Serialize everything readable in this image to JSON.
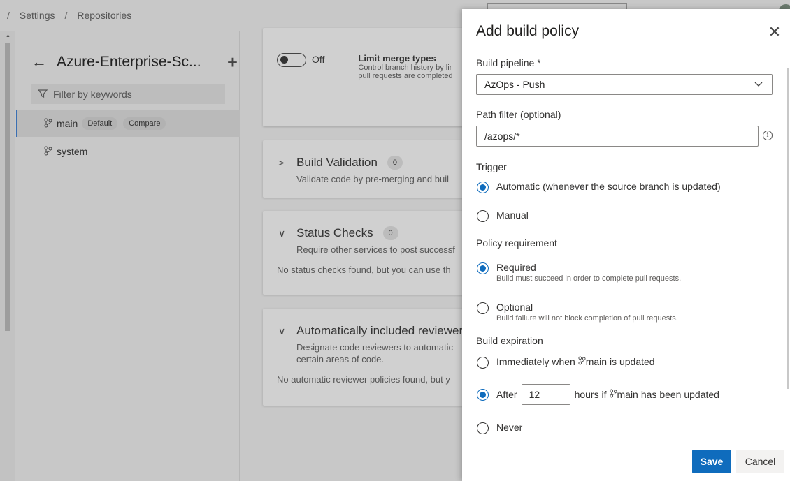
{
  "breadcrumb": {
    "items": [
      "Settings",
      "Repositories"
    ],
    "separator": "/"
  },
  "branches_panel": {
    "repo_name": "Azure-Enterprise-Sc...",
    "filter_placeholder": "Filter by keywords",
    "branches": [
      {
        "name": "main",
        "badges": [
          "Default",
          "Compare"
        ],
        "selected": true
      },
      {
        "name": "system",
        "badges": [],
        "selected": false
      }
    ]
  },
  "policies": {
    "merge_types": {
      "toggle_label": "Off",
      "title": "Limit merge types",
      "desc_line1": "Control branch history by lir",
      "desc_line2": "pull requests are completed"
    },
    "build_validation": {
      "title": "Build Validation",
      "count": "0",
      "desc": "Validate code by pre-merging and buil"
    },
    "status_checks": {
      "title": "Status Checks",
      "count": "0",
      "desc": "Require other services to post successf",
      "note": "No status checks found, but you can use th"
    },
    "reviewers": {
      "title": "Automatically included reviewer",
      "desc_line1": "Designate code reviewers to automatic",
      "desc_line2": "certain areas of code.",
      "note": "No automatic reviewer policies found, but y"
    }
  },
  "dialog": {
    "title": "Add build policy",
    "build_pipeline_label": "Build pipeline *",
    "build_pipeline_value": "AzOps - Push",
    "path_filter_label": "Path filter (optional)",
    "path_filter_value": "/azops/*",
    "trigger_label": "Trigger",
    "trigger_options": [
      {
        "label": "Automatic (whenever the source branch is updated)",
        "checked": true
      },
      {
        "label": "Manual",
        "checked": false
      }
    ],
    "requirement_label": "Policy requirement",
    "requirement_options": [
      {
        "label": "Required",
        "sub": "Build must succeed in order to complete pull requests.",
        "checked": true
      },
      {
        "label": "Optional",
        "sub": "Build failure will not block completion of pull requests.",
        "checked": false
      }
    ],
    "expiration_label": "Build expiration",
    "expiration_immediately_prefix": "Immediately when",
    "expiration_branch": "main",
    "expiration_immediately_suffix": "is updated",
    "expiration_after_prefix": "After",
    "expiration_hours": "12",
    "expiration_after_suffix": "hours if",
    "expiration_after_suffix2": "has been updated",
    "expiration_never": "Never",
    "save_label": "Save",
    "cancel_label": "Cancel",
    "accent_color": "#0f6cbd"
  }
}
